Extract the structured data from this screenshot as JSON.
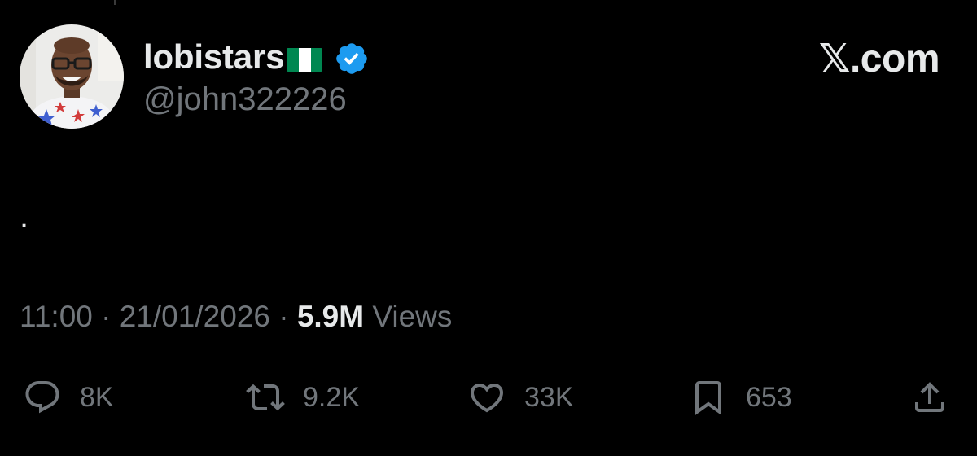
{
  "profile": {
    "display_name": "lobistars",
    "flag": "Nigeria flag",
    "verified_badge": "verified-badge-icon",
    "handle": "@john322226"
  },
  "brand": {
    "logo_text": "𝕏.com"
  },
  "tweet": {
    "text": "."
  },
  "meta": {
    "time": "11:00",
    "separator": " · ",
    "date": "21/01/2026",
    "views_count": "5.9M",
    "views_label": "Views"
  },
  "actions": {
    "replies": {
      "icon": "reply-icon",
      "count": "8K"
    },
    "reposts": {
      "icon": "repost-icon",
      "count": "9.2K"
    },
    "likes": {
      "icon": "heart-icon",
      "count": "33K"
    },
    "bookmarks": {
      "icon": "bookmark-icon",
      "count": "653"
    },
    "share": {
      "icon": "share-icon"
    }
  },
  "colors": {
    "background": "#000000",
    "primary_text": "#e7e9ea",
    "secondary_text": "#71767b",
    "verified_blue": "#1d9bf0",
    "flag_green": "#008751"
  }
}
